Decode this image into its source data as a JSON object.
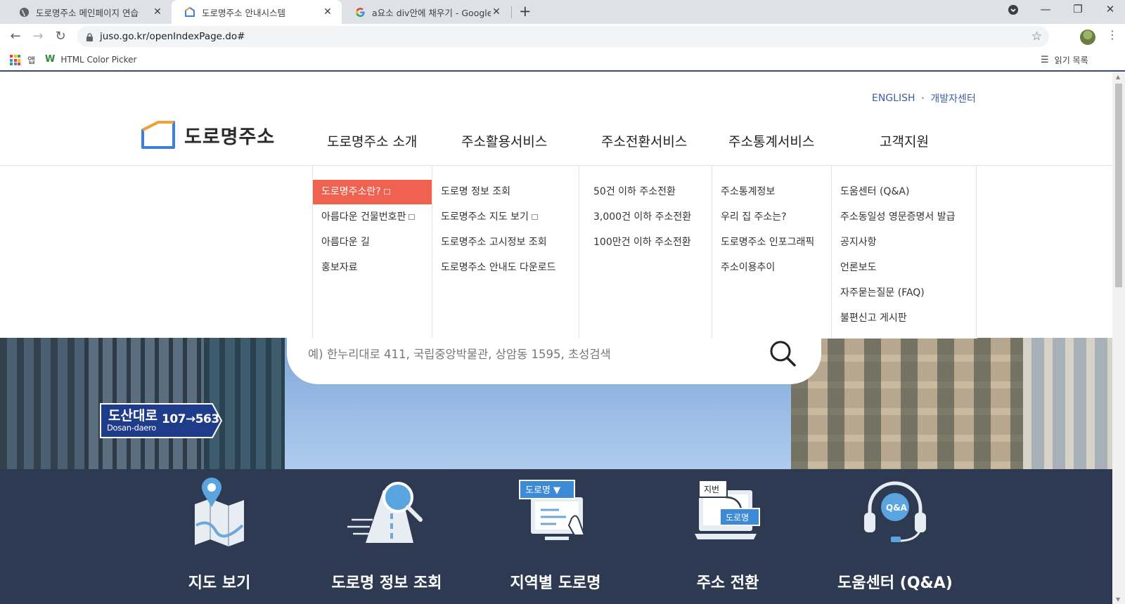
{
  "browser": {
    "tabs": [
      {
        "title": "도로명주소 메인페이지 연습",
        "active": false
      },
      {
        "title": "도로명주소 안내시스템",
        "active": true
      },
      {
        "title": "a요소 div안에 채우기 - Google",
        "active": false
      }
    ],
    "url": "juso.go.kr/openIndexPage.do#",
    "bookmarks": [
      {
        "label": "앱",
        "icon": "apps-grid-icon"
      },
      {
        "label": "HTML Color Picker",
        "icon": "w-logo-icon"
      }
    ],
    "reading_list": "읽기 목록"
  },
  "site": {
    "logo_text": "도로명주소",
    "top_links": {
      "english": "ENGLISH",
      "dev": "개발자센터"
    },
    "gnb": [
      "도로명주소 소개",
      "주소활용서비스",
      "주소전환서비스",
      "주소통계서비스",
      "고객지원"
    ],
    "mega_menu": [
      {
        "items": [
          {
            "label": "도로명주소란?",
            "active": true,
            "external": true
          },
          {
            "label": "아름다운 건물번호판",
            "external": true
          },
          {
            "label": "아름다운 길"
          },
          {
            "label": "홍보자료"
          }
        ]
      },
      {
        "items": [
          {
            "label": "도로명 정보 조회"
          },
          {
            "label": "도로명주소 지도 보기",
            "external": true
          },
          {
            "label": "도로명주소 고시정보 조회"
          },
          {
            "label": "도로명주소 안내도 다운로드"
          }
        ]
      },
      {
        "items": [
          {
            "label": "50건 이하 주소전환"
          },
          {
            "label": "3,000건 이하 주소전환"
          },
          {
            "label": "100만건 이하 주소전환"
          }
        ]
      },
      {
        "items": [
          {
            "label": "주소통계정보"
          },
          {
            "label": "우리 집 주소는?"
          },
          {
            "label": "도로명주소 인포그래픽"
          },
          {
            "label": "주소이용추이"
          }
        ]
      },
      {
        "items": [
          {
            "label": "도움센터 (Q&A)"
          },
          {
            "label": "주소동일성 영문증명서 발급"
          },
          {
            "label": "공지사항"
          },
          {
            "label": "언론보도"
          },
          {
            "label": "자주묻는질문 (FAQ)"
          },
          {
            "label": "불편신고 게시판"
          }
        ]
      }
    ],
    "search": {
      "placeholder": "예) 한누리대로 411, 국립중앙박물관, 상암동 1595, 초성검색"
    },
    "road_sign": {
      "korean": "도산대로",
      "english": "Dosan-daero",
      "numbers": "107→563"
    },
    "quick_links": [
      {
        "label": "지도 보기",
        "icon": "map-icon"
      },
      {
        "label": "도로명 정보 조회",
        "icon": "road-search-icon"
      },
      {
        "label": "지역별 도로명",
        "icon": "region-road-icon",
        "badge": "도로명 ▼"
      },
      {
        "label": "주소 전환",
        "icon": "address-convert-icon",
        "badge_top": "지번",
        "badge_bottom": "도로명"
      },
      {
        "label": "도움센터 (Q&A)",
        "icon": "help-center-icon",
        "badge": "Q&A"
      }
    ],
    "colors": {
      "accent": "#f0624f",
      "band": "#2e3a52",
      "link": "#3c5fa0",
      "logo_blue": "#3d7fd9",
      "logo_orange": "#f0a23a"
    }
  }
}
